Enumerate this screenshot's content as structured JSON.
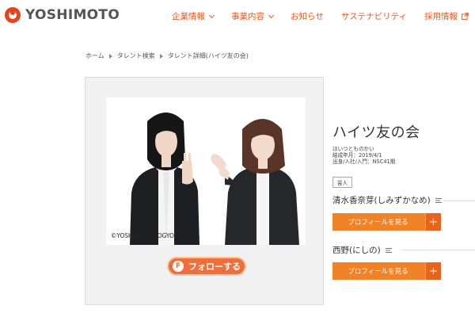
{
  "header": {
    "logo_text": "YOSHIMOTO",
    "nav": [
      {
        "label": "企業情報",
        "icon": "chevron-down-icon"
      },
      {
        "label": "事業内容",
        "icon": "chevron-down-icon"
      },
      {
        "label": "お知らせ"
      },
      {
        "label": "サステナビリティ"
      },
      {
        "label": "採用情報",
        "icon": "external-link-icon"
      }
    ]
  },
  "breadcrumb": [
    "ホーム",
    "タレント検索",
    "タレント詳細(ハイツ友の会)"
  ],
  "photo": {
    "copyright": "©YOSHIMOTO KOGYO CO.,LTD."
  },
  "follow_button": {
    "icon_text": "F",
    "label": "フォローする"
  },
  "talent": {
    "name": "ハイツ友の会",
    "info": [
      "はいつとものかい",
      "結成年月：2019/4/1",
      "出身/入社/入門：NSC41期"
    ],
    "tag": "芸人",
    "members": [
      {
        "name": "清水香奈芽(しみずかなめ)",
        "button": "プロフィールを見る",
        "plus": "+"
      },
      {
        "name": "西野(にしの)",
        "button": "プロフィールを見る",
        "plus": "+"
      }
    ]
  },
  "colors": {
    "brand_orange": "#e85a1e",
    "button_orange": "#f08228",
    "follow_pink": "#ee6e3c"
  }
}
